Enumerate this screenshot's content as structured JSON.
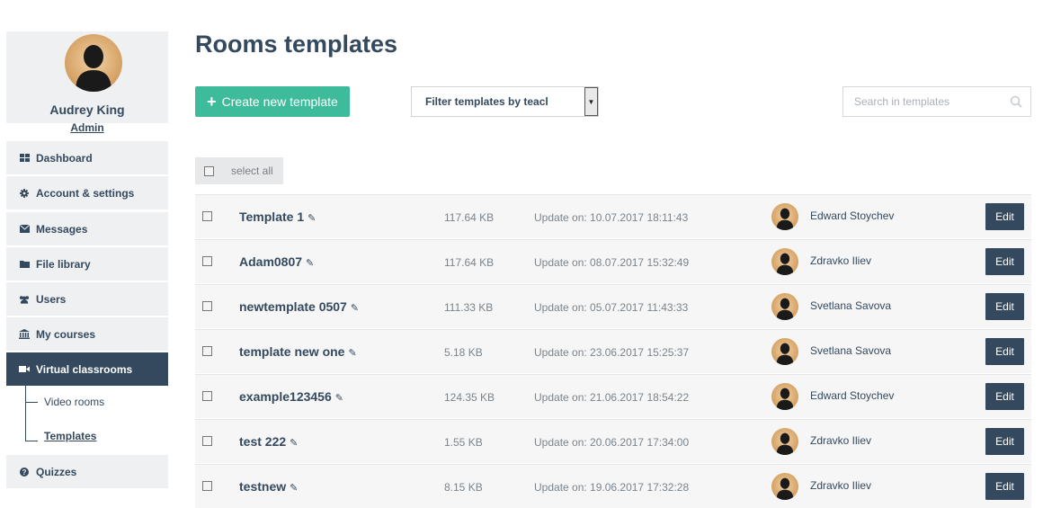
{
  "profile": {
    "name": "Audrey King",
    "role": "Admin"
  },
  "nav": [
    {
      "label": "Dashboard",
      "icon": "dashboard-icon"
    },
    {
      "label": "Account & settings",
      "icon": "gear-icon"
    },
    {
      "label": "Messages",
      "icon": "envelope-icon"
    },
    {
      "label": "File library",
      "icon": "folder-icon"
    },
    {
      "label": "Users",
      "icon": "users-icon"
    },
    {
      "label": "My courses",
      "icon": "institution-icon"
    },
    {
      "label": "Virtual classrooms",
      "icon": "video-camera-icon"
    },
    {
      "label": "Quizzes",
      "icon": "question-icon"
    }
  ],
  "subnav": [
    {
      "label": "Video rooms"
    },
    {
      "label": "Templates"
    }
  ],
  "main": {
    "title": "Rooms templates",
    "create_label": "Create new template",
    "filter_value": "Filter templates by teach",
    "search_placeholder": "Search in templates",
    "select_all_label": "select all",
    "edit_label": "Edit"
  },
  "templates": [
    {
      "name": "Template 1",
      "size": "117.64 KB",
      "updated": "Update on: 10.07.2017 18:11:43",
      "owner": "Edward Stoychev"
    },
    {
      "name": "Adam0807",
      "size": "117.64 KB",
      "updated": "Update on: 08.07.2017 15:32:49",
      "owner": "Zdravko Iliev"
    },
    {
      "name": "newtemplate 0507",
      "size": "111.33 KB",
      "updated": "Update on: 05.07.2017 11:43:33",
      "owner": "Svetlana Savova"
    },
    {
      "name": "template new one",
      "size": "5.18 KB",
      "updated": "Update on: 23.06.2017 15:25:37",
      "owner": "Svetlana Savova"
    },
    {
      "name": "example123456",
      "size": "124.35 KB",
      "updated": "Update on: 21.06.2017 18:54:22",
      "owner": "Edward Stoychev"
    },
    {
      "name": "test 222",
      "size": "1.55 KB",
      "updated": "Update on: 20.06.2017 17:34:00",
      "owner": "Zdravko Iliev"
    },
    {
      "name": "testnew",
      "size": "8.15 KB",
      "updated": "Update on: 19.06.2017 17:32:28",
      "owner": "Zdravko Iliev"
    }
  ],
  "colors": {
    "accent": "#3dbb9b",
    "dark": "#34495e",
    "sidebar_bg": "#eef0f1",
    "row_bg": "#f6f6f6"
  }
}
